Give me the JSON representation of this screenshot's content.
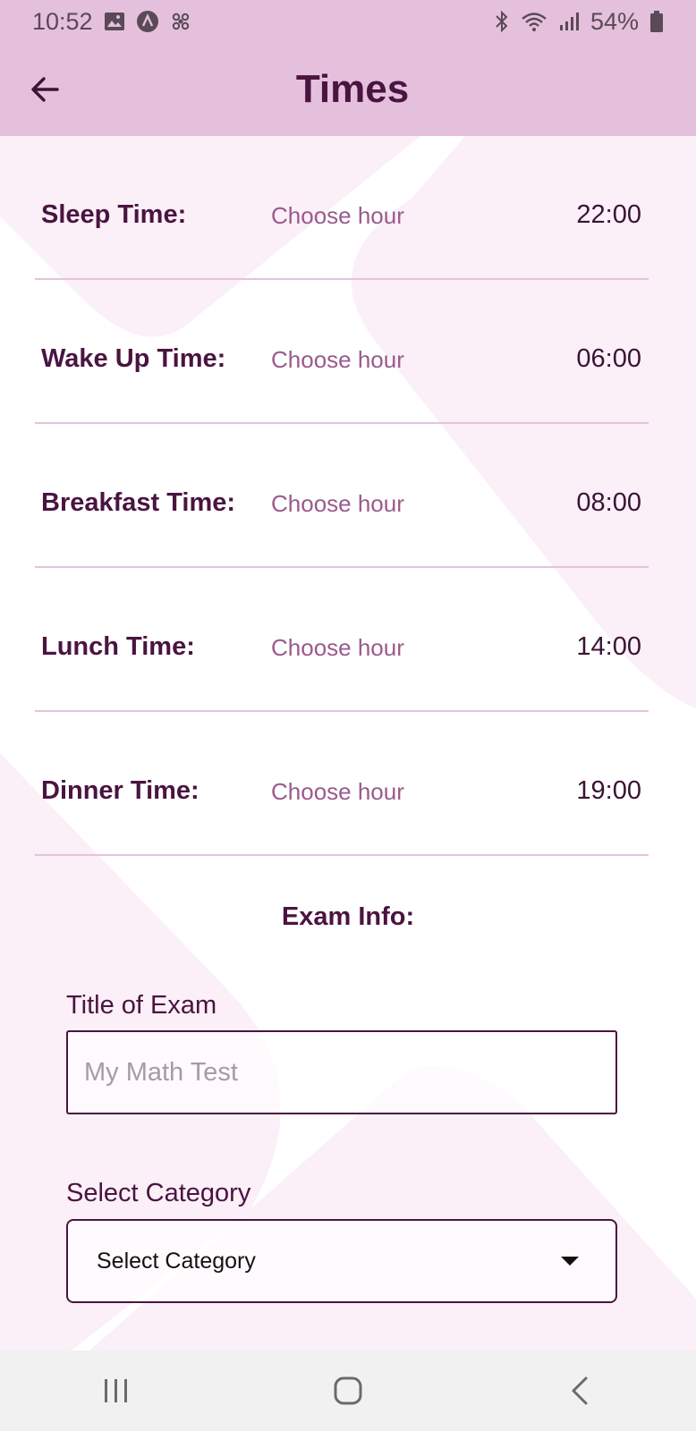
{
  "status_bar": {
    "time": "10:52",
    "battery": "54%",
    "icons_left": [
      "image-icon",
      "a-circle-icon",
      "fan-icon"
    ],
    "icons_right": [
      "bluetooth-icon",
      "wifi-icon",
      "signal-icon",
      "battery-icon"
    ]
  },
  "app_bar": {
    "title": "Times",
    "back_icon": "arrow-left-icon"
  },
  "time_rows": [
    {
      "label": "Sleep Time:",
      "choose": "Choose hour",
      "value": "22:00"
    },
    {
      "label": "Wake Up Time:",
      "choose": "Choose hour",
      "value": "06:00"
    },
    {
      "label": "Breakfast Time:",
      "choose": "Choose hour",
      "value": "08:00"
    },
    {
      "label": "Lunch Time:",
      "choose": "Choose hour",
      "value": "14:00"
    },
    {
      "label": "Dinner Time:",
      "choose": "Choose hour",
      "value": "19:00"
    }
  ],
  "exam": {
    "heading": "Exam Info:",
    "title_label": "Title of Exam",
    "title_placeholder": "My Math Test",
    "title_value": "",
    "category_label": "Select Category",
    "category_value": "Select Category"
  },
  "nav_bar": {
    "icons": [
      "recent-apps-icon",
      "home-icon",
      "back-icon"
    ]
  },
  "colors": {
    "primary": "#4a1440",
    "app_bar": "#e4c0dc",
    "accent_text": "#9a5a8c",
    "divider": "#e2c4dc",
    "background_shape": "#fbeff8"
  }
}
